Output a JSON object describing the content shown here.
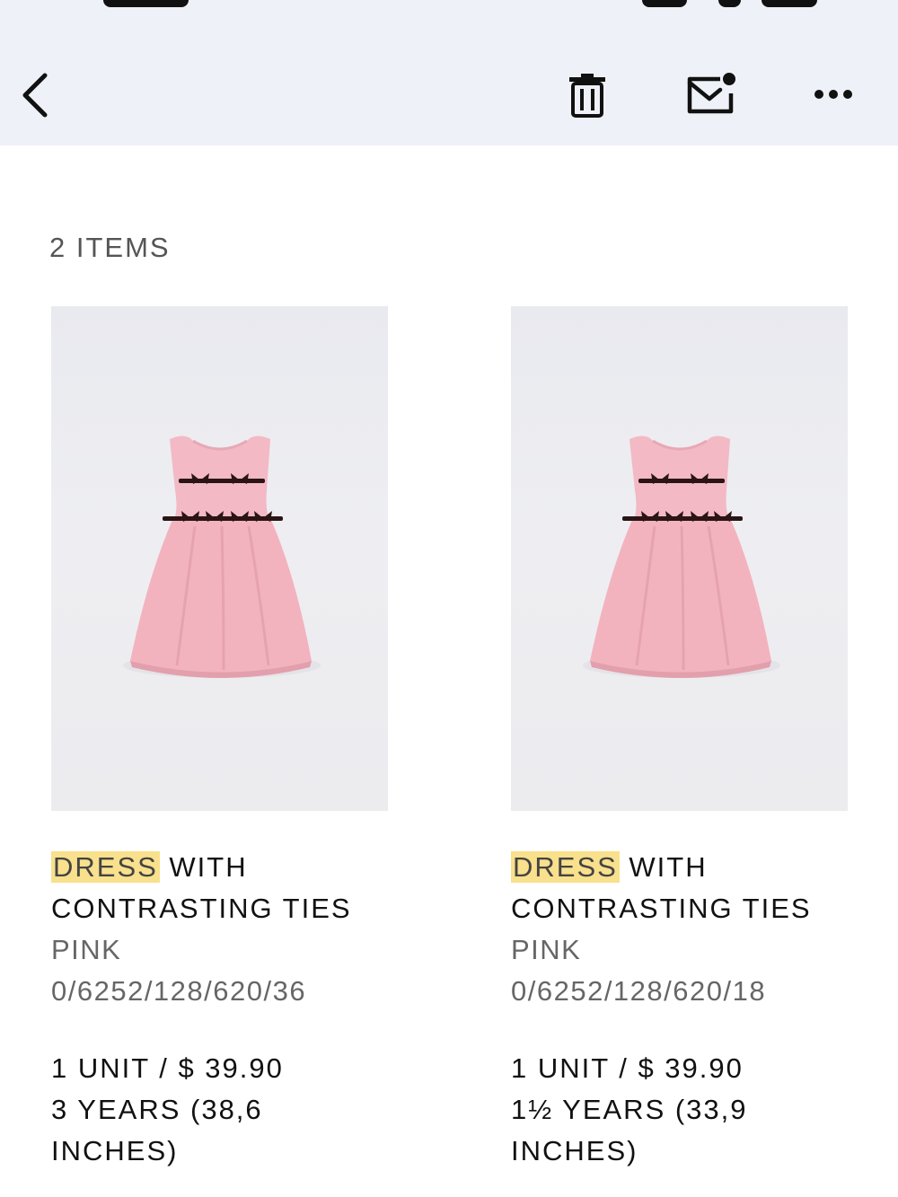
{
  "toolbar": {
    "icons": [
      "chevron-left-icon",
      "trash-icon",
      "mail-unread-icon",
      "more-horizontal-icon"
    ]
  },
  "order": {
    "items_count": "2 ITEMS",
    "items": [
      {
        "name_highlight": "DRESS",
        "name_rest": " WITH CONTRASTING TIES",
        "color": "PINK",
        "reference": "0/6252/128/620/36",
        "quantity_price": "1 UNIT / $ 39.90",
        "size": "3 YEARS (38,6 INCHES)"
      },
      {
        "name_highlight": "DRESS",
        "name_rest": " WITH CONTRASTING TIES",
        "color": "PINK",
        "reference": "0/6252/128/620/18",
        "quantity_price": "1 UNIT / $ 39.90",
        "size": "1½ YEARS (33,9 INCHES)"
      }
    ]
  },
  "colors": {
    "toolbar_bg": "#eef1f8",
    "highlight": "#f9e08c",
    "dress_pink": "#f3b9c4",
    "ties": "#2a1414"
  }
}
